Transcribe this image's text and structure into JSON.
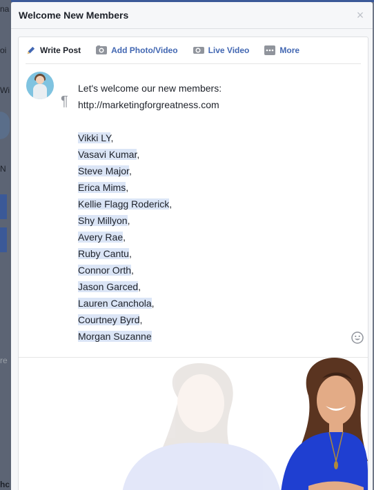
{
  "background": {
    "fragments": [
      "na",
      "oi",
      "Wi",
      "D",
      "N",
      "re",
      "hc"
    ]
  },
  "modal": {
    "title": "Welcome New Members",
    "close_label": "×"
  },
  "tabs": [
    {
      "label": "Write Post",
      "icon": "pencil-icon",
      "active": true
    },
    {
      "label": "Add Photo/Video",
      "icon": "camera-icon",
      "active": false
    },
    {
      "label": "Live Video",
      "icon": "video-camera-icon",
      "active": false
    },
    {
      "label": "More",
      "icon": "more-icon",
      "active": false
    }
  ],
  "post": {
    "intro": "Let's welcome our new members:",
    "url": "http://marketingforgreatness.com",
    "members": [
      {
        "name": "Vikki LY",
        "sep": ","
      },
      {
        "name": "Vasavi Kumar",
        "sep": ","
      },
      {
        "name": "Steve Major",
        "sep": ","
      },
      {
        "name": "Erica Mims",
        "sep": ","
      },
      {
        "name": "Kellie Flagg Roderick",
        "sep": ","
      },
      {
        "name": "Shy Millyon",
        "sep": ","
      },
      {
        "name": "Avery Rae",
        "sep": ","
      },
      {
        "name": "Ruby Cantu",
        "sep": ","
      },
      {
        "name": "Connor Orth",
        "sep": ","
      },
      {
        "name": "Jason Garced",
        "sep": ","
      },
      {
        "name": "Lauren Canchola",
        "sep": ","
      },
      {
        "name": "Courtney Byrd",
        "sep": ","
      },
      {
        "name": "Morgan Suzanne",
        "sep": ""
      }
    ]
  },
  "colors": {
    "link_blue": "#4267b2",
    "highlight": "#dbe5f6",
    "dress_blue": "#1f3fd1"
  }
}
